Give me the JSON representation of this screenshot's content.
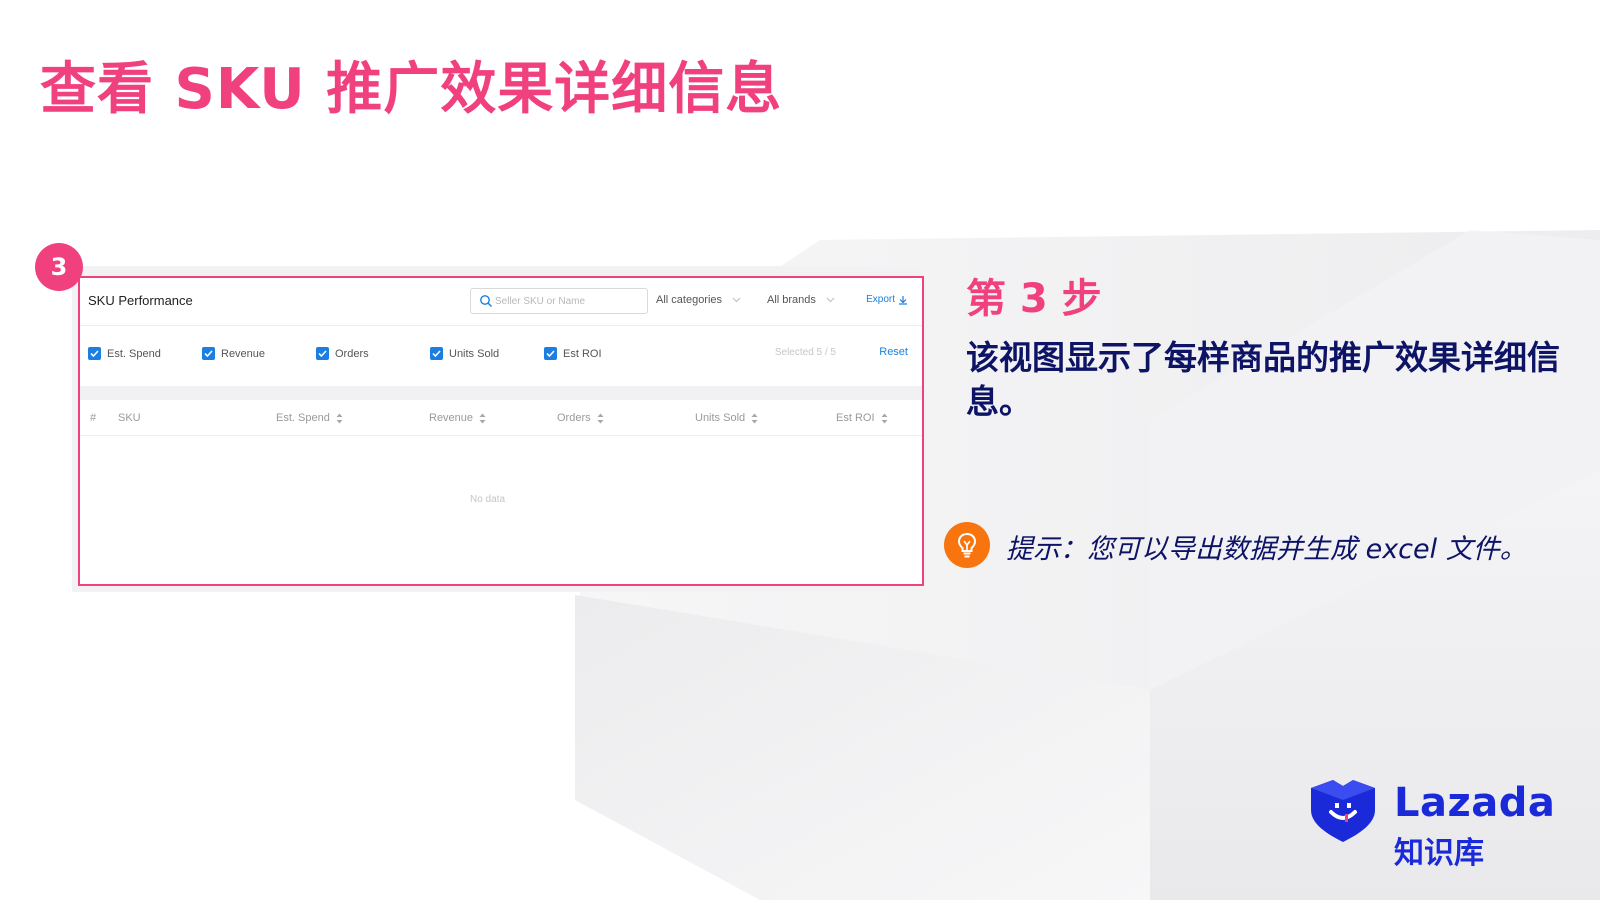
{
  "slide": {
    "title": "查看 SKU 推广效果详细信息",
    "badge": "3"
  },
  "panel": {
    "title": "SKU Performance",
    "search_placeholder": "Seller SKU or Name",
    "category_filter": "All categories",
    "brand_filter": "All brands",
    "export_label": "Export",
    "metrics": [
      "Est. Spend",
      "Revenue",
      "Orders",
      "Units Sold",
      "Est ROI"
    ],
    "selected_text": "Selected  5  /  5",
    "reset_label": "Reset",
    "columns": {
      "index": "#",
      "sku": "SKU",
      "est_spend": "Est. Spend",
      "revenue": "Revenue",
      "orders": "Orders",
      "units_sold": "Units Sold",
      "est_roi": "Est ROI"
    },
    "empty_text": "No data"
  },
  "step": {
    "label": "第 3 步",
    "description": "该视图显示了每样商品的推广效果详细信息。"
  },
  "tip": {
    "text": "提示：您可以导出数据并生成 excel 文件。"
  },
  "logo": {
    "brand": "Lazada",
    "subtitle": "知识库"
  },
  "colors": {
    "accent_pink": "#f0407e",
    "navy": "#0e1465",
    "link_blue": "#1a7fe0",
    "tip_orange": "#f7740f",
    "logo_blue": "#1a2ad8"
  }
}
